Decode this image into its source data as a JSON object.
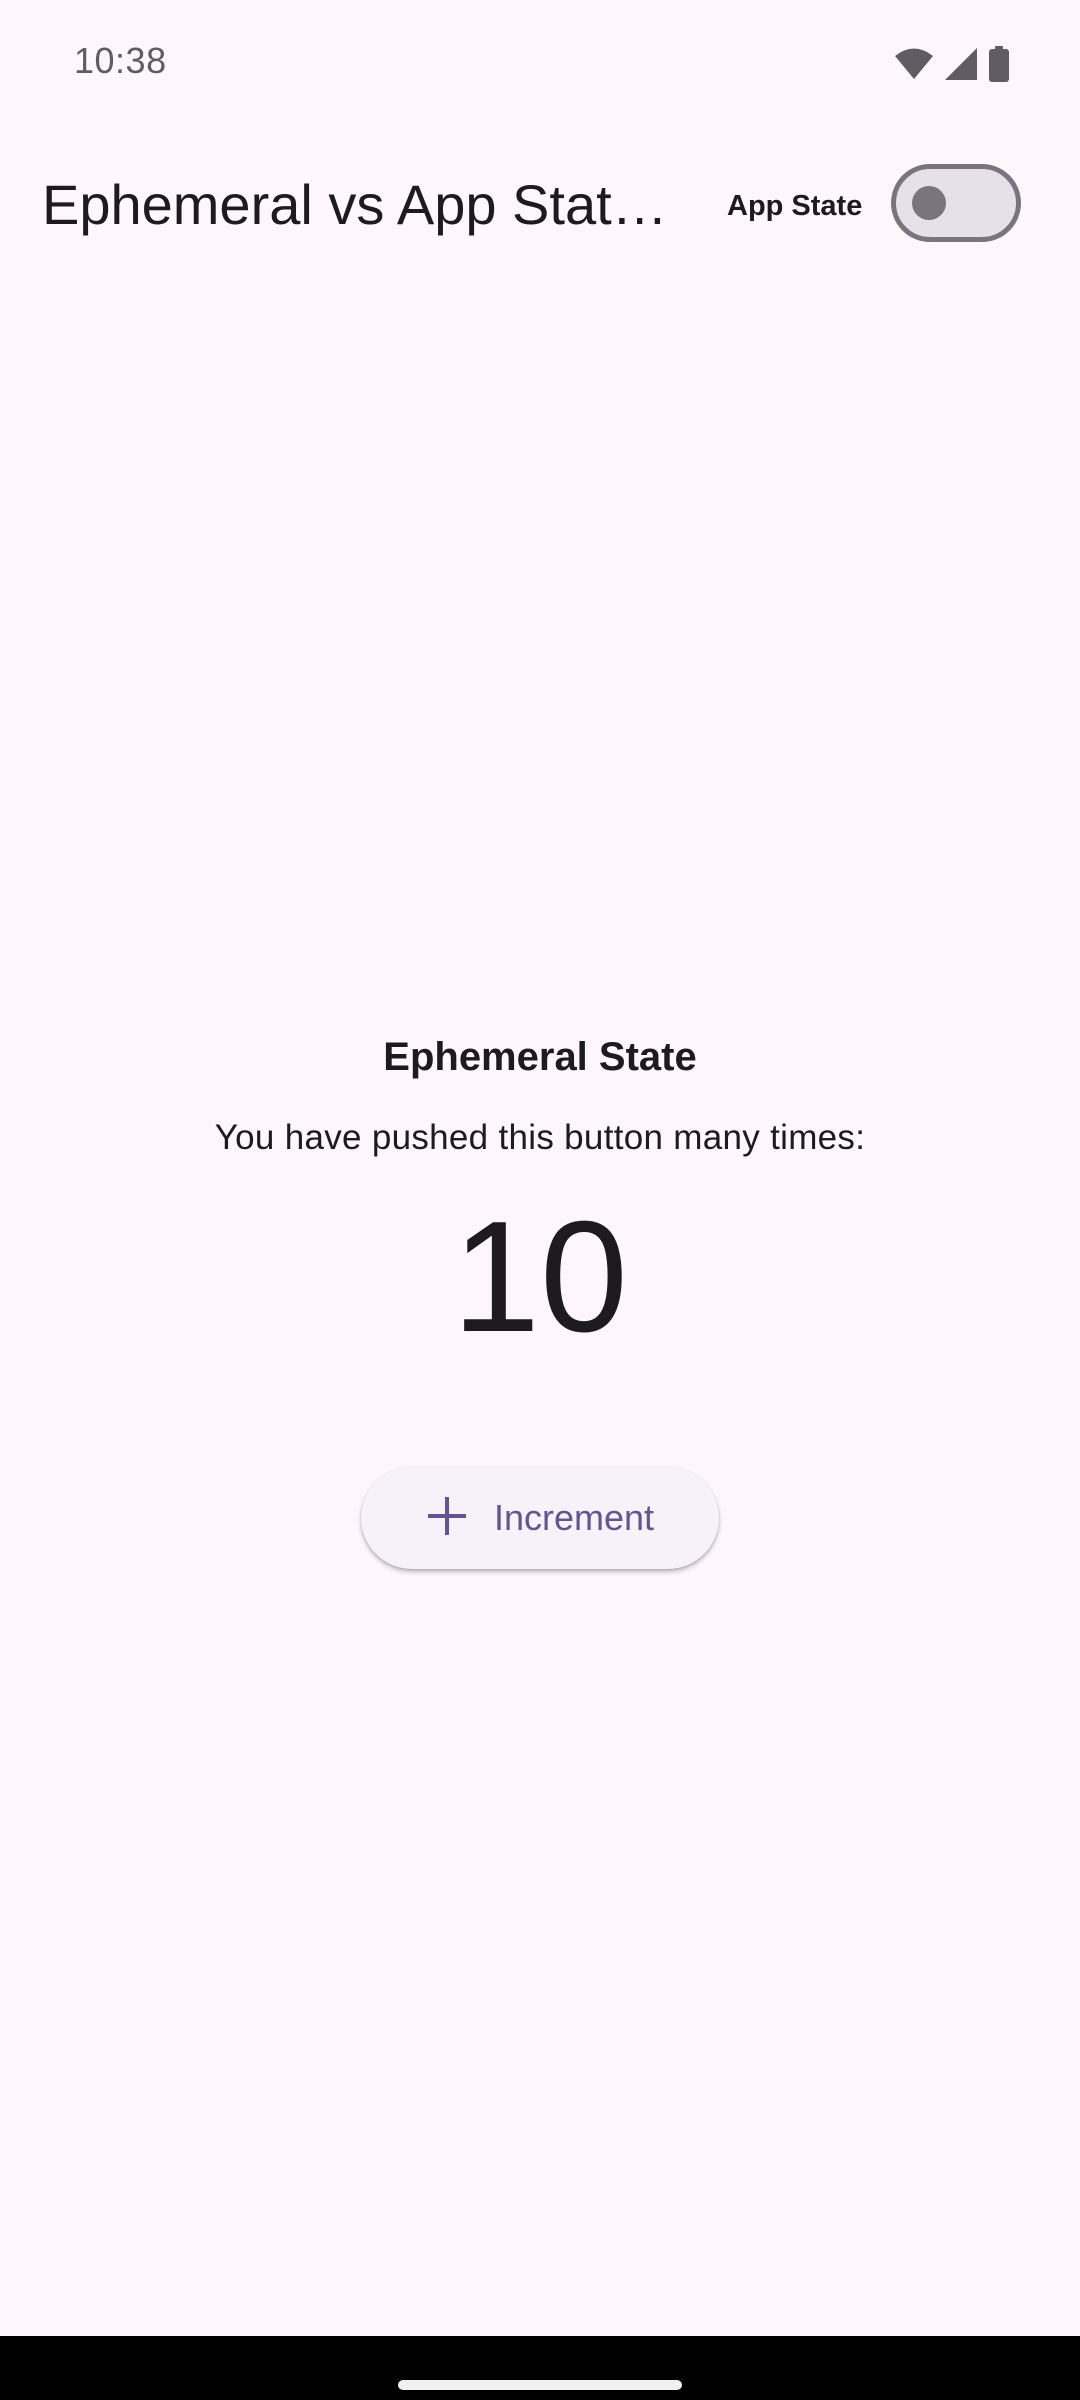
{
  "status_bar": {
    "time": "10:38",
    "icons": [
      "wifi-icon",
      "signal-icon",
      "battery-icon"
    ]
  },
  "app_bar": {
    "title": "Ephemeral vs App Stat…",
    "toggle_label": "App State",
    "toggle_on": false
  },
  "main": {
    "heading": "Ephemeral State",
    "subtitle": "You have pushed this button many times:",
    "counter": "10",
    "increment_label": "Increment",
    "increment_icon": "plus-icon"
  },
  "colors": {
    "background": "#fdf7fc",
    "accent": "#65558f",
    "switch_outline": "#79747e",
    "switch_track": "#e6e0e9",
    "button_surface": "#f7f2fa"
  }
}
